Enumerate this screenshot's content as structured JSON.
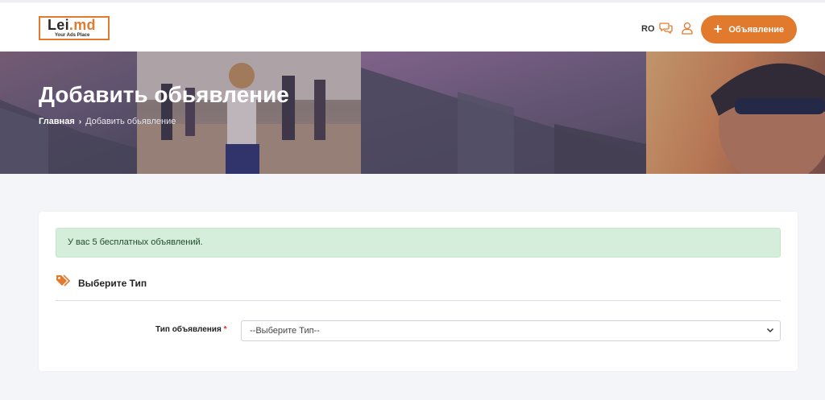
{
  "header": {
    "logo_main": "Lei",
    "logo_dot": ".md",
    "logo_tagline": "Your Ads Place",
    "language": "RO",
    "add_button_label": "Объявление"
  },
  "banner": {
    "title": "Добавить обьявление",
    "breadcrumb": {
      "home": "Главная",
      "current": "Добавить обьявление"
    }
  },
  "card": {
    "alert_text": "У вас 5 бесплатных объявлений.",
    "section_title": "Выберите Тип",
    "form": {
      "type_label": "Тип объявления",
      "required_mark": "*",
      "type_selected": "--Выберите Тип--"
    }
  },
  "colors": {
    "accent": "#e27a2e",
    "alert_bg": "#d5eddb",
    "page_bg": "#f4f5f9"
  },
  "icons": {
    "chat": "chat-bubbles-icon",
    "user": "user-icon",
    "tags": "tags-icon",
    "chevron": "chevron-down-icon",
    "breadcrumb_sep": "chevron-right-icon"
  }
}
